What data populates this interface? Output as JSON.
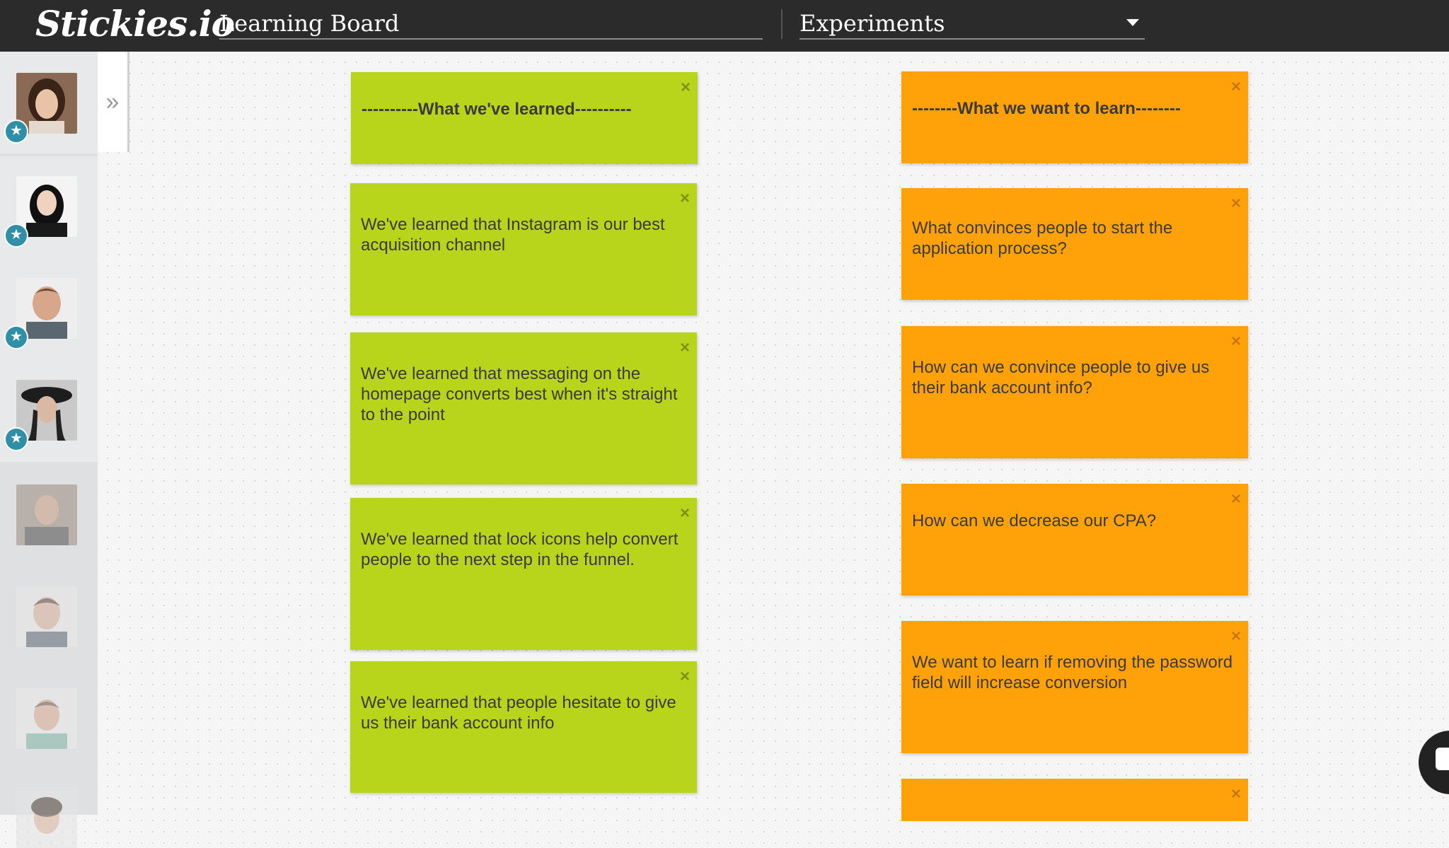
{
  "app": {
    "logo": "Stickies.io",
    "board_title": "Learning Board",
    "board_select": "Experiments"
  },
  "sidebar": {
    "expand_label": "»",
    "star_glyph": "★",
    "members": [
      {
        "name": "member-1",
        "starred": true
      },
      {
        "name": "member-2",
        "starred": true
      },
      {
        "name": "member-3",
        "starred": true
      },
      {
        "name": "member-4",
        "starred": true
      },
      {
        "name": "member-5",
        "starred": false
      },
      {
        "name": "member-6",
        "starred": false
      },
      {
        "name": "member-7",
        "starred": false
      },
      {
        "name": "member-8",
        "starred": false
      }
    ]
  },
  "board": {
    "close_glyph": "×",
    "learned": {
      "header": "----------What we've learned----------",
      "notes": [
        "We've learned that Instagram is our best acquisition channel",
        "We've learned that messaging on the homepage converts best when it's straight to the point",
        "We've learned that lock icons help convert people to the next step in the funnel.",
        "We've learned that people hesitate to give us their bank account info"
      ]
    },
    "want_to_learn": {
      "header": "--------What we want to learn--------",
      "notes": [
        "What convinces people to start the application process?",
        "How can we convince people to give us their bank account info?",
        "How can we decrease our CPA?",
        "We want to learn if removing the password field will increase conversion"
      ]
    }
  },
  "colors": {
    "topbar": "#2b2b2b",
    "green_note": "#b8d51b",
    "orange_note": "#ffa108",
    "star_badge": "#2f8fa6"
  }
}
